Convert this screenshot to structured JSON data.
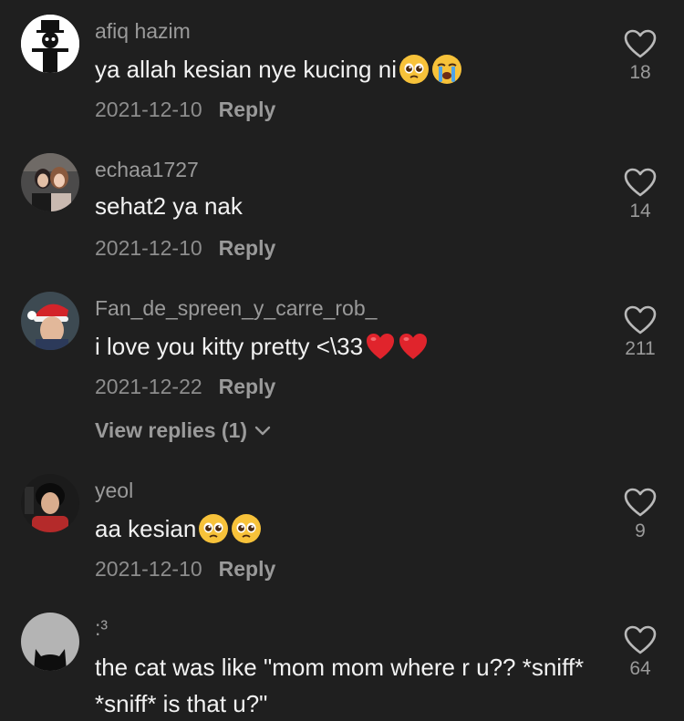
{
  "comments": [
    {
      "username": "afiq hazim",
      "text": "ya allah kesian nye kucing ni",
      "emojis": [
        "pleading-face-emoji",
        "crying-face-emoji"
      ],
      "date": "2021-12-10",
      "reply_label": "Reply",
      "likes": "18",
      "avatar_icon": "snowman-avatar"
    },
    {
      "username": "echaa1727",
      "text": "sehat2 ya nak",
      "emojis": [],
      "date": "2021-12-10",
      "reply_label": "Reply",
      "likes": "14",
      "avatar_icon": "photo-avatar"
    },
    {
      "username": "Fan_de_spreen_y_carre_rob_",
      "text": "i love you kitty pretty <\\33",
      "emojis": [
        "red-heart-emoji",
        "red-heart-emoji"
      ],
      "date": "2021-12-22",
      "reply_label": "Reply",
      "likes": "211",
      "avatar_icon": "santa-hat-avatar",
      "view_replies": "View replies (1)"
    },
    {
      "username": "yeol",
      "text": "aa kesian",
      "emojis": [
        "pleading-face-emoji",
        "pleading-face-emoji"
      ],
      "date": "2021-12-10",
      "reply_label": "Reply",
      "likes": "9",
      "avatar_icon": "photo-avatar"
    },
    {
      "username": ":³",
      "text": "the cat was like \"mom mom where r u?? *sniff* *sniff* is that u?\"",
      "emojis": [],
      "likes": "64",
      "avatar_icon": "cat-silhouette-avatar"
    }
  ],
  "colors": {
    "background": "#1f1f1f",
    "username": "#9a9a9a",
    "text": "#f2f2f2",
    "meta": "#8d8d8d",
    "heart_emoji": "#e0242c",
    "face_emoji": "#f7c23a"
  }
}
